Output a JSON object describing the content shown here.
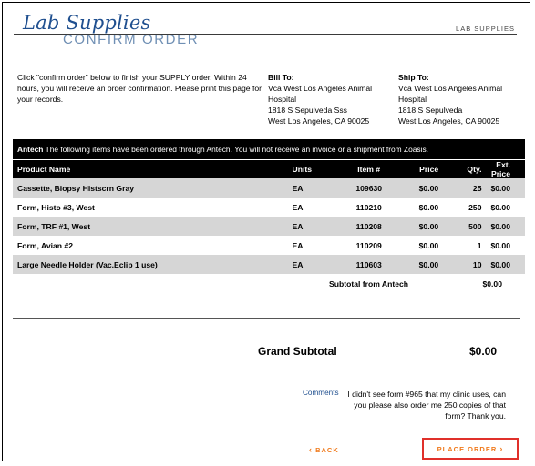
{
  "header": {
    "title": "Lab Supplies",
    "subtitle": "Confirm Order",
    "brand_right": "Lab Supplies"
  },
  "intro": {
    "text": "Click \"confirm order\" below to finish your SUPPLY order. Within 24 hours, you will receive an order confirmation. Please print this page for your records."
  },
  "bill_to": {
    "label": "Bill To:",
    "name": "Vca West Los Angeles Animal Hospital",
    "street": "1818 S Sepulveda Sss",
    "city": "West Los Angeles, CA 90025"
  },
  "ship_to": {
    "label": "Ship To:",
    "name": "Vca West Los Angeles Animal Hospital",
    "street": "1818 S Sepulveda",
    "city": "West Los Angeles, CA 90025"
  },
  "vendor": {
    "name": "Antech",
    "notice": "The following items have been ordered through Antech. You will not receive an invoice or a shipment from Zoasis."
  },
  "table": {
    "headers": {
      "name": "Product Name",
      "units": "Units",
      "item": "Item #",
      "price": "Price",
      "qty": "Qty.",
      "ext": "Ext. Price"
    },
    "rows": [
      {
        "name": "Cassette, Biopsy Histscrn Gray",
        "units": "EA",
        "item": "109630",
        "price": "$0.00",
        "qty": "25",
        "ext": "$0.00"
      },
      {
        "name": "Form, Histo #3, West",
        "units": "EA",
        "item": "110210",
        "price": "$0.00",
        "qty": "250",
        "ext": "$0.00"
      },
      {
        "name": "Form, TRF #1, West",
        "units": "EA",
        "item": "110208",
        "price": "$0.00",
        "qty": "500",
        "ext": "$0.00"
      },
      {
        "name": "Form, Avian #2",
        "units": "EA",
        "item": "110209",
        "price": "$0.00",
        "qty": "1",
        "ext": "$0.00"
      },
      {
        "name": "Large Needle Holder (Vac.Eclip 1 use)",
        "units": "EA",
        "item": "110603",
        "price": "$0.00",
        "qty": "10",
        "ext": "$0.00"
      }
    ],
    "subtotal_label": "Subtotal from Antech",
    "subtotal_value": "$0.00"
  },
  "grand": {
    "label": "Grand Subtotal",
    "value": "$0.00"
  },
  "comments": {
    "label": "Comments",
    "text": "I didn't see form #965 that my clinic uses, can you please also order me 250 copies of that form? Thank you."
  },
  "actions": {
    "back_label": "Back",
    "place_order_label": "Place Order",
    "back_arrow": "chevron-left-icon",
    "place_arrow": "chevron-right-icon"
  },
  "colors": {
    "title": "#1f4f8f",
    "subtitle": "#6f8fb4",
    "action": "#f07a1c",
    "highlight_border": "#e0302a",
    "row_alt": "#d6d6d6"
  }
}
